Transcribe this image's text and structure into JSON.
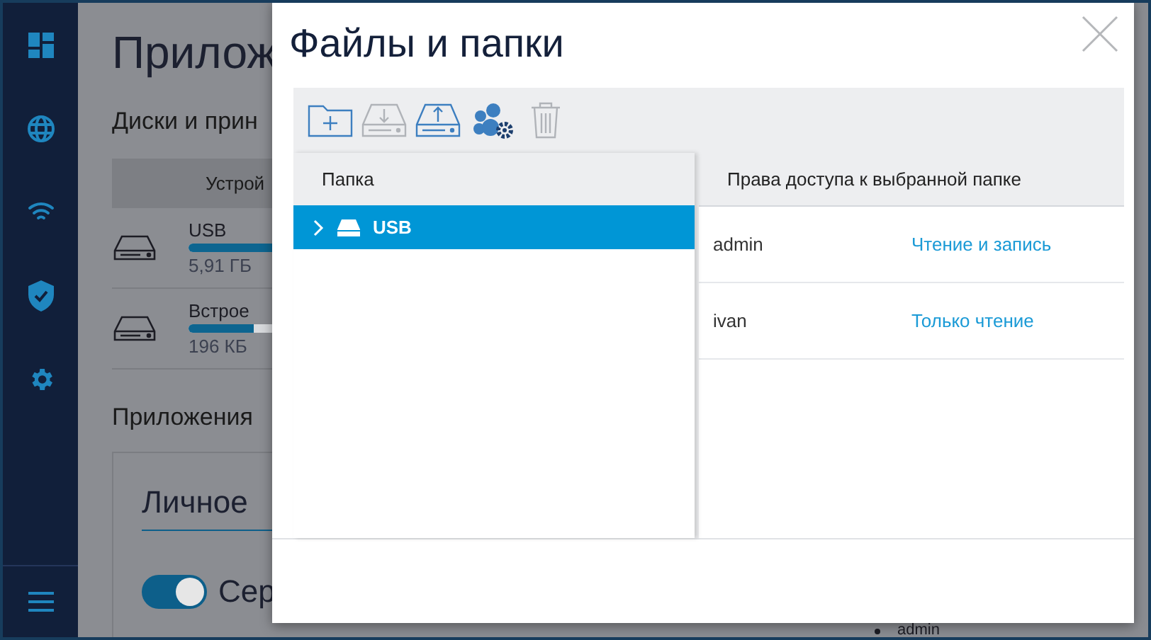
{
  "sidebar": {
    "items": [
      {
        "kind": "dashboard"
      },
      {
        "kind": "globe"
      },
      {
        "kind": "wifi"
      },
      {
        "kind": "shield"
      },
      {
        "kind": "gear"
      }
    ],
    "menu": {
      "kind": "menu"
    }
  },
  "page": {
    "title": "Прилож",
    "disks_heading": "Диски и прин",
    "table_header": "Устрой",
    "disks": [
      {
        "name": "USB",
        "level": 0.95,
        "size": "5,91 ГБ"
      },
      {
        "name": "Встрое",
        "level": 0.38,
        "size": "196 КБ"
      }
    ],
    "apps_heading": "Приложения",
    "card_title": "Личное",
    "toggle": {
      "on": true,
      "label": "Сер"
    },
    "bullet": "admin"
  },
  "dialog": {
    "title": "Файлы и папки",
    "toolbar": [
      {
        "kind": "new-folder",
        "disabled": false
      },
      {
        "kind": "download",
        "disabled": true
      },
      {
        "kind": "upload",
        "disabled": false
      },
      {
        "kind": "users",
        "disabled": false
      },
      {
        "kind": "delete",
        "disabled": true
      }
    ],
    "folders": {
      "header": "Папка",
      "items": [
        {
          "name": "USB",
          "selected": true,
          "expanded": false
        }
      ]
    },
    "permissions": {
      "header": "Права доступа к выбранной папке",
      "rows": [
        {
          "user": "admin",
          "access": "Чтение и запись"
        },
        {
          "user": "ivan",
          "access": "Только чтение"
        }
      ]
    }
  }
}
